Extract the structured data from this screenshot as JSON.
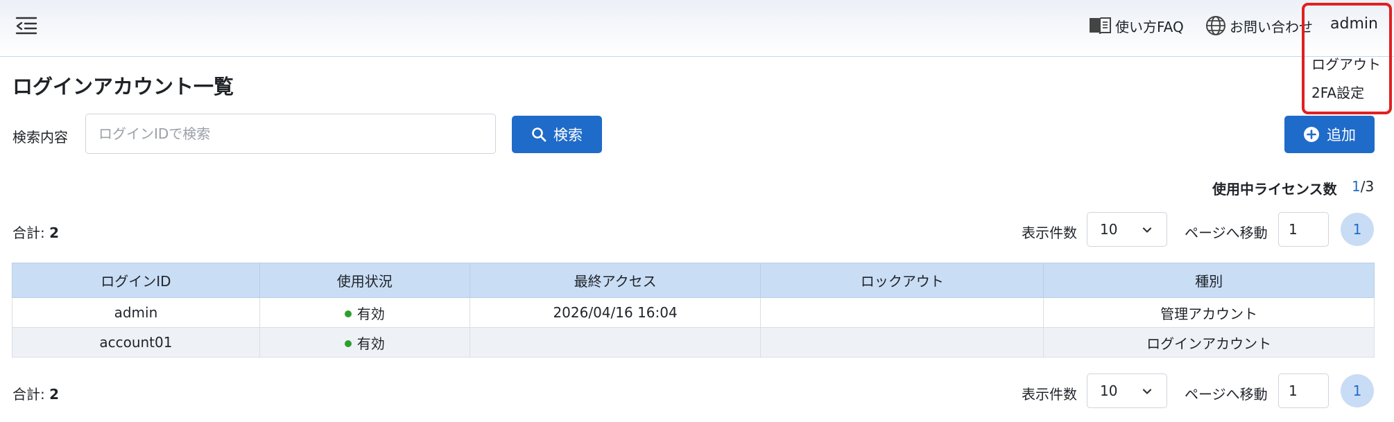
{
  "header": {
    "faq_label": "使い方FAQ",
    "contact_label": "お問い合わせ",
    "user_name": "admin"
  },
  "user_menu": {
    "items": [
      {
        "label": "ログアウト"
      },
      {
        "label": "2FA設定"
      }
    ]
  },
  "page": {
    "title": "ログインアカウント一覧"
  },
  "search": {
    "label": "検索内容",
    "placeholder": "ログインIDで検索",
    "value": "",
    "button_label": "検索"
  },
  "add_button_label": "追加",
  "license": {
    "label": "使用中ライセンス数",
    "used": "1",
    "total": "/3"
  },
  "pagination": {
    "total_label": "合計: ",
    "total_value": "2",
    "per_page_label": "表示件数",
    "per_page_value": "10",
    "goto_label": "ページへ移動",
    "goto_value": "1",
    "current_page": "1"
  },
  "table": {
    "columns": [
      "ログインID",
      "使用状況",
      "最終アクセス",
      "ロックアウト",
      "種別"
    ],
    "rows": [
      {
        "login_id": "admin",
        "status": "有効",
        "last_access": "2026/04/16 16:04",
        "lockout": "",
        "type": "管理アカウント"
      },
      {
        "login_id": "account01",
        "status": "有効",
        "last_access": "",
        "lockout": "",
        "type": "ログインアカウント"
      }
    ]
  },
  "colors": {
    "primary": "#1f6bc9",
    "table_header": "#c9ddf5",
    "status_active": "#2ca02c",
    "highlight": "#e02020"
  }
}
